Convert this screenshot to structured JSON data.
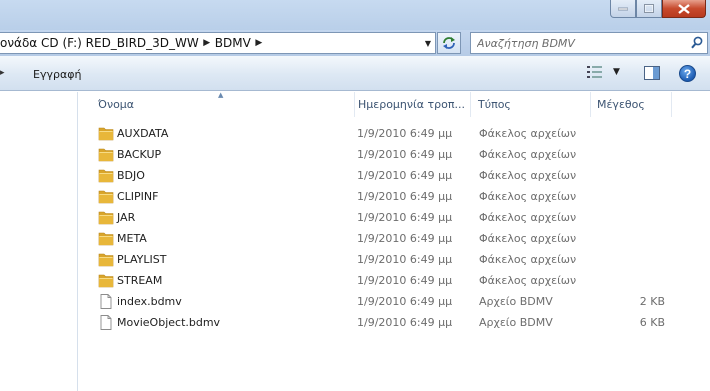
{
  "window": {
    "controls": {
      "minimize": "minimize",
      "maximize": "maximize",
      "close": "close"
    }
  },
  "address": {
    "crumbs": [
      "ονάδα CD (F:) RED_BIRD_3D_WW",
      "BDMV"
    ]
  },
  "search": {
    "placeholder": "Αναζήτηση BDMV"
  },
  "commandbar": {
    "burn_label": "Εγγραφή"
  },
  "columns": {
    "name": "Όνομα",
    "date": "Ημερομηνία τροπ...",
    "type": "Τύπος",
    "size": "Μέγεθος"
  },
  "files": [
    {
      "name": "AUXDATA",
      "date": "1/9/2010 6:49 μμ",
      "type": "Φάκελος αρχείων",
      "size": "",
      "icon": "folder-icon"
    },
    {
      "name": "BACKUP",
      "date": "1/9/2010 6:49 μμ",
      "type": "Φάκελος αρχείων",
      "size": "",
      "icon": "folder-icon"
    },
    {
      "name": "BDJO",
      "date": "1/9/2010 6:49 μμ",
      "type": "Φάκελος αρχείων",
      "size": "",
      "icon": "folder-icon"
    },
    {
      "name": "CLIPINF",
      "date": "1/9/2010 6:49 μμ",
      "type": "Φάκελος αρχείων",
      "size": "",
      "icon": "folder-icon"
    },
    {
      "name": "JAR",
      "date": "1/9/2010 6:49 μμ",
      "type": "Φάκελος αρχείων",
      "size": "",
      "icon": "folder-icon"
    },
    {
      "name": "META",
      "date": "1/9/2010 6:49 μμ",
      "type": "Φάκελος αρχείων",
      "size": "",
      "icon": "folder-icon"
    },
    {
      "name": "PLAYLIST",
      "date": "1/9/2010 6:49 μμ",
      "type": "Φάκελος αρχείων",
      "size": "",
      "icon": "folder-icon"
    },
    {
      "name": "STREAM",
      "date": "1/9/2010 6:49 μμ",
      "type": "Φάκελος αρχείων",
      "size": "",
      "icon": "folder-icon"
    },
    {
      "name": "index.bdmv",
      "date": "1/9/2010 6:49 μμ",
      "type": "Αρχείο BDMV",
      "size": "2 KB",
      "icon": "file-icon"
    },
    {
      "name": "MovieObject.bdmv",
      "date": "1/9/2010 6:49 μμ",
      "type": "Αρχείο BDMV",
      "size": "6 KB",
      "icon": "file-icon"
    }
  ],
  "colors": {
    "folder": "#e8b73a",
    "header_text": "#3c5472",
    "secondary_text": "#6d6d6d"
  }
}
